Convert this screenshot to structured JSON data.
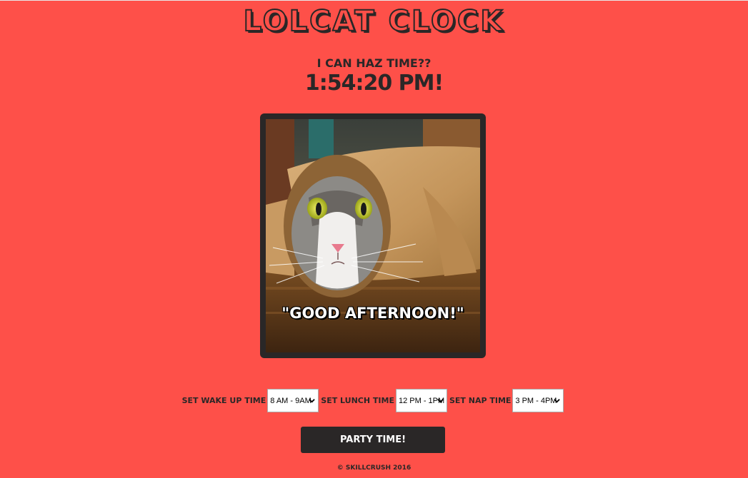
{
  "header": {
    "title": "LOLCAT CLOCK",
    "subtitle": "I CAN HAZ TIME??",
    "time": "1:54:20 PM!"
  },
  "image": {
    "caption": "\"GOOD AFTERNOON!\""
  },
  "controls": {
    "wakeup_label": "SET WAKE UP TIME",
    "wakeup_value": "8 AM - 9AM",
    "lunch_label": "SET LUNCH TIME",
    "lunch_value": "12 PM - 1PM",
    "nap_label": "SET NAP TIME",
    "nap_value": "3 PM - 4PM"
  },
  "party_button": {
    "label": "PARTY TIME!"
  },
  "footer": {
    "text": "© SKILLCRUSH 2016"
  },
  "colors": {
    "background": "#fe5049",
    "dark": "#2a2727"
  }
}
